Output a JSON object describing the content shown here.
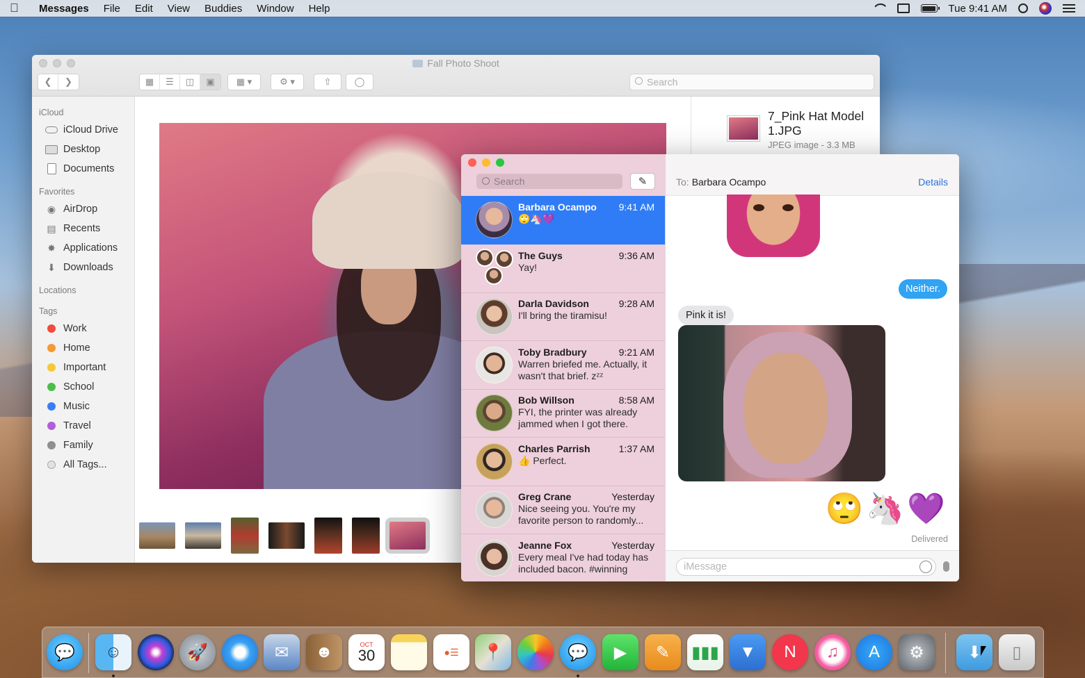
{
  "menubar": {
    "apple_icon": "apple-logo",
    "app_name": "Messages",
    "menus": [
      "File",
      "Edit",
      "View",
      "Buddies",
      "Window",
      "Help"
    ],
    "clock": "Tue 9:41 AM",
    "status_icons": [
      "wifi-icon",
      "airplay-icon",
      "battery-icon",
      "search-icon",
      "siri-icon",
      "notification-center-icon"
    ]
  },
  "finder": {
    "title": "Fall Photo Shoot",
    "search_placeholder": "Search",
    "sidebar": {
      "icloud_label": "iCloud",
      "icloud_items": [
        "iCloud Drive",
        "Desktop",
        "Documents"
      ],
      "favorites_label": "Favorites",
      "favorites_items": [
        "AirDrop",
        "Recents",
        "Applications",
        "Downloads"
      ],
      "locations_label": "Locations",
      "tags_label": "Tags",
      "tags": [
        {
          "label": "Work",
          "color": "#f04b3f"
        },
        {
          "label": "Home",
          "color": "#f39a36"
        },
        {
          "label": "Important",
          "color": "#f5c836"
        },
        {
          "label": "School",
          "color": "#4cbd4a"
        },
        {
          "label": "Music",
          "color": "#3d7df2"
        },
        {
          "label": "Travel",
          "color": "#b25ed8"
        },
        {
          "label": "Family",
          "color": "#8f8f8f"
        }
      ],
      "all_tags": "All Tags..."
    },
    "preview": {
      "file_name": "7_Pink Hat Model 1.JPG",
      "file_meta": "JPEG image - 3.3 MB"
    }
  },
  "messages": {
    "search_placeholder": "Search",
    "conversations": [
      {
        "name": "Barbara Ocampo",
        "time": "9:41 AM",
        "preview": "🙄🦄💜",
        "selected": true
      },
      {
        "name": "The Guys",
        "time": "9:36 AM",
        "preview": "Yay!"
      },
      {
        "name": "Darla Davidson",
        "time": "9:28 AM",
        "preview": "I'll bring the tiramisu!"
      },
      {
        "name": "Toby Bradbury",
        "time": "9:21 AM",
        "preview": "Warren briefed me. Actually, it wasn't that brief. zᶻᶻ"
      },
      {
        "name": "Bob Willson",
        "time": "8:58 AM",
        "preview": "FYI, the printer was already jammed when I got there."
      },
      {
        "name": "Charles Parrish",
        "time": "1:37 AM",
        "preview": "👍 Perfect."
      },
      {
        "name": "Greg Crane",
        "time": "Yesterday",
        "preview": "Nice seeing you. You're my favorite person to randomly..."
      },
      {
        "name": "Jeanne Fox",
        "time": "Yesterday",
        "preview": "Every meal I've had today has included bacon. #winning"
      }
    ],
    "header": {
      "to_label": "To:",
      "recipient": "Barbara Ocampo",
      "details": "Details"
    },
    "thread": {
      "outgoing_text": "Neither.",
      "incoming_text": "Pink it is!",
      "emoji_message": "🙄🦄💜",
      "status": "Delivered"
    },
    "input_placeholder": "iMessage"
  },
  "dock": {
    "apps": [
      "Messages (Downloading)",
      "Finder",
      "Siri",
      "Launchpad",
      "Safari",
      "Mail",
      "Contacts",
      "Calendar",
      "Notes",
      "Reminders",
      "Maps",
      "Photos",
      "Messages",
      "FaceTime",
      "Pages",
      "Numbers",
      "Keynote",
      "News",
      "iTunes",
      "App Store",
      "System Preferences",
      "Downloads",
      "Trash"
    ],
    "calendar_month": "OCT",
    "calendar_day": "30"
  }
}
